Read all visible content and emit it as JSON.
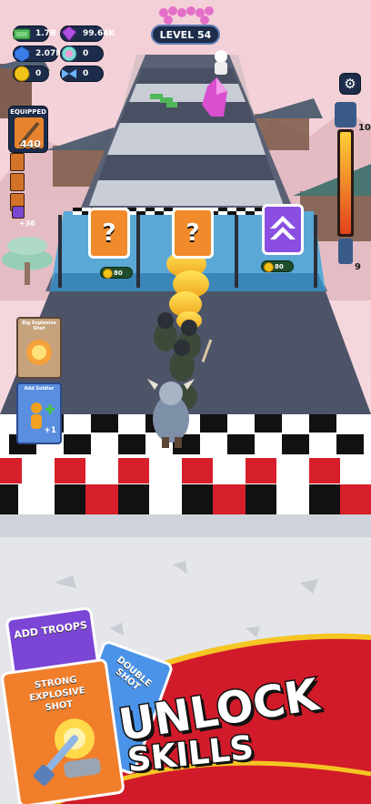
{
  "hud": {
    "money": "1.7B",
    "gems": "99.64K",
    "blue_gems": "2.07M",
    "coins": "0",
    "rainbow_gems": "0",
    "tickets": "0",
    "level": "LEVEL 54",
    "equipped_label": "EQUIPPED",
    "equipped_power": "440",
    "inventory_count": "+36",
    "meter_top": "10",
    "meter_bottom": "9"
  },
  "gates": [
    {
      "symbol": "?",
      "price": "80",
      "color": "#f08a2a"
    },
    {
      "symbol": "?",
      "price": "",
      "color": "#f08a2a"
    },
    {
      "symbol": "",
      "price": "80",
      "color": "#8a4fe0"
    }
  ],
  "side_cards": [
    {
      "label": "Big Explosive Shot"
    },
    {
      "label": "Add Soldier",
      "bonus": "+1"
    }
  ],
  "promo": {
    "cards": [
      "ADD TROOPS",
      "DOUBLE SHOT",
      "STRONG EXPLOSIVE SHOT"
    ],
    "title_line1": "UNLOCK",
    "title_line2": "SKILLS"
  },
  "colors": {
    "track": "#4b5266",
    "sky": "#f2d6dc",
    "banner": "#d11b2a",
    "panel": "#1d2c4a"
  }
}
